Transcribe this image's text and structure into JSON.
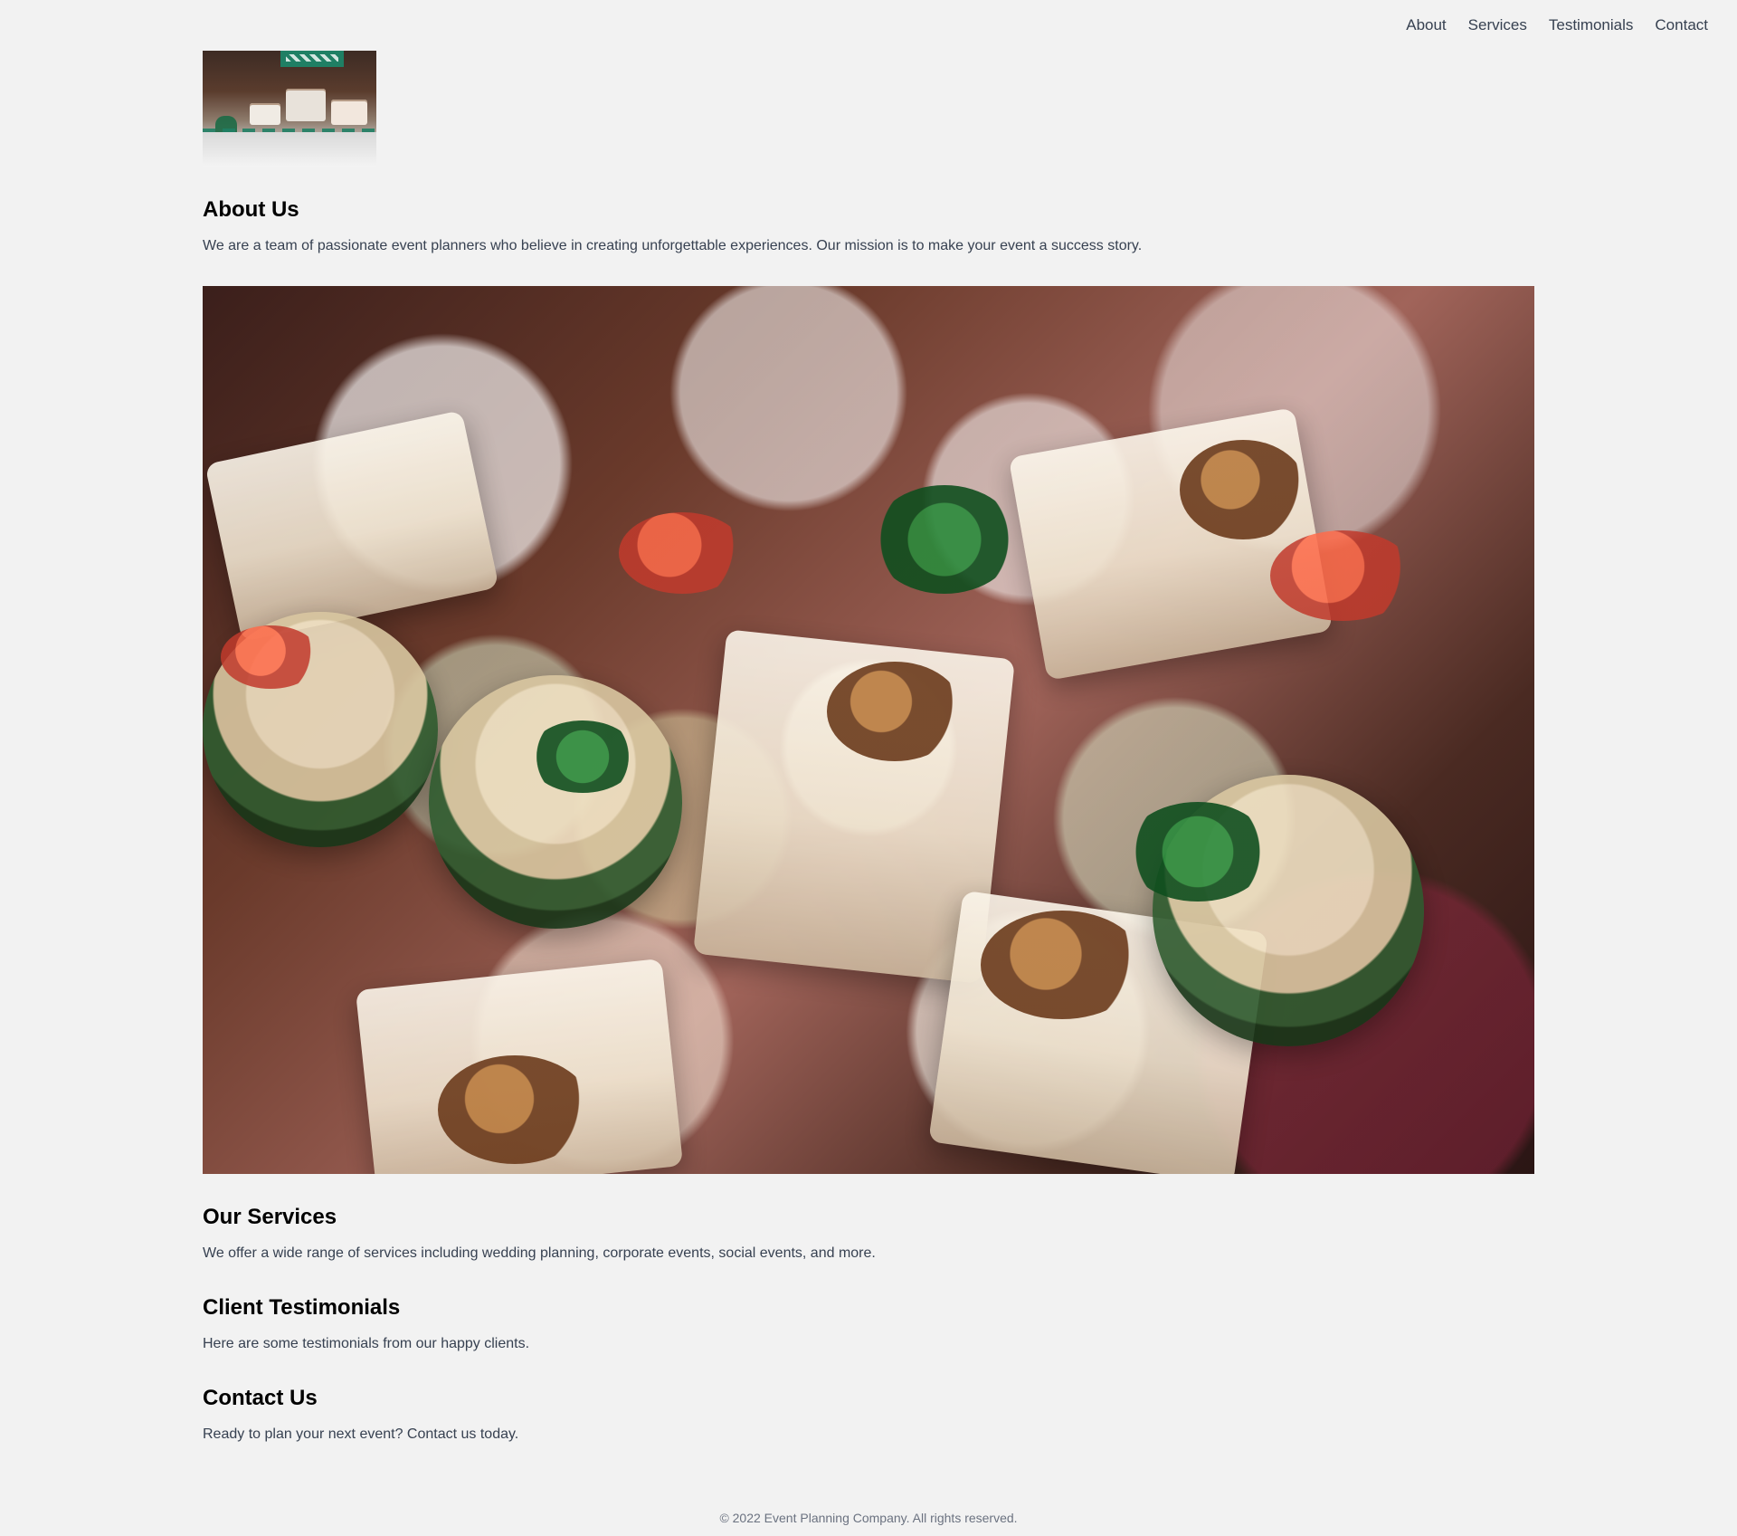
{
  "nav": {
    "items": [
      {
        "label": "About"
      },
      {
        "label": "Services"
      },
      {
        "label": "Testimonials"
      },
      {
        "label": "Contact"
      }
    ]
  },
  "about": {
    "title": "About Us",
    "text": "We are a team of passionate event planners who believe in creating unforgettable experiences. Our mission is to make your event a success story."
  },
  "services": {
    "title": "Our Services",
    "text": "We offer a wide range of services including wedding planning, corporate events, social events, and more."
  },
  "testimonials": {
    "title": "Client Testimonials",
    "text": "Here are some testimonials from our happy clients."
  },
  "contact": {
    "title": "Contact Us",
    "text": "Ready to plan your next event? Contact us today."
  },
  "footer": {
    "text": "© 2022 Event Planning Company. All rights reserved."
  }
}
